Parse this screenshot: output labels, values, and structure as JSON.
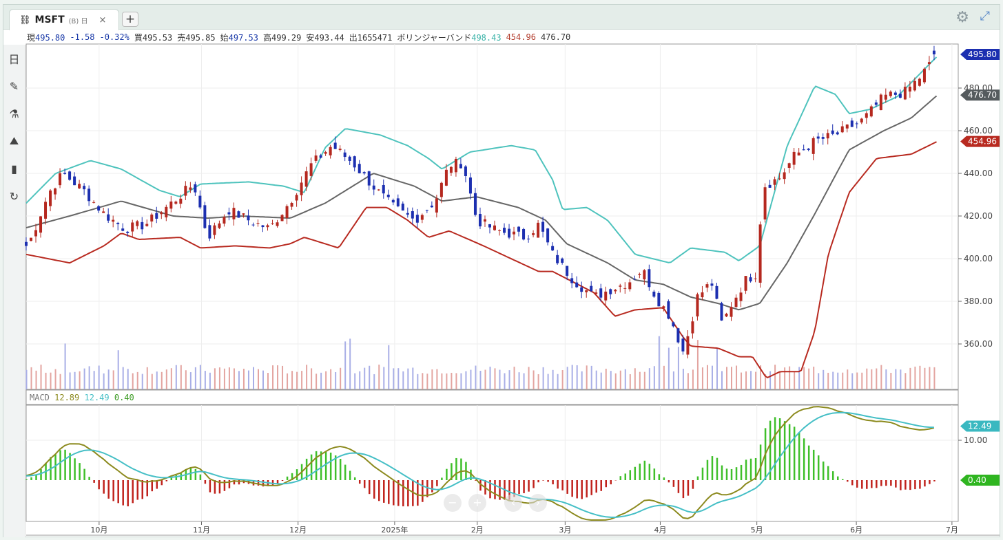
{
  "tab": {
    "symbol": "MSFT",
    "sub": "(B) 日",
    "close": "×",
    "add": "+"
  },
  "info": {
    "cur_l": "現",
    "cur": "495.80",
    "chg": "-1.58",
    "pct": "-0.32%",
    "bid_l": "買",
    "bid": "495.53",
    "ask_l": "売",
    "ask": "495.85",
    "open_l": "始",
    "open": "497.53",
    "high_l": "高",
    "high": "499.29",
    "low_l": "安",
    "low": "493.44",
    "vol_l": "出",
    "vol": "1655471",
    "bb_l": "ボリンジャーバンド",
    "bb_up": "498.43",
    "bb_lo": "454.96",
    "bb_mid": "476.70"
  },
  "macd_legend": {
    "label": "MACD",
    "macd": "12.89",
    "signal": "12.49",
    "hist": "0.40"
  },
  "toolbar": [
    {
      "icon": "calendar-icon",
      "g": "日"
    },
    {
      "icon": "pen-icon",
      "g": "✎"
    },
    {
      "icon": "flask-icon",
      "g": "⚗"
    },
    {
      "icon": "mountain-icon",
      "g": "⛰"
    },
    {
      "icon": "bar-chart-icon",
      "g": "▮"
    },
    {
      "icon": "refresh-icon",
      "g": "↻"
    }
  ],
  "colors": {
    "up": "#b5281f",
    "down": "#1c2fb0",
    "upper": "#4ec3bd",
    "mid": "#666666",
    "lower": "#b82a20",
    "macd": "#8c8a1e",
    "signal": "#45bfc6",
    "hist_pos": "#3fbf2a",
    "hist_neg": "#c0221c"
  },
  "chart_data": {
    "type": "candlestick",
    "x_range_days": [
      0,
      193
    ],
    "y_range": [
      342,
      500
    ],
    "y_ticks": [
      "480.00",
      "460.00",
      "440.00",
      "420.00",
      "400.00",
      "380.00",
      "360.00"
    ],
    "y_tick_values": [
      480,
      460,
      440,
      420,
      400,
      380,
      360
    ],
    "month_ticks": [
      {
        "label": "10月",
        "day": 15.1
      },
      {
        "label": "11月",
        "day": 36.3
      },
      {
        "label": "12月",
        "day": 56.3
      },
      {
        "label": "2025年",
        "day": 76.3
      },
      {
        "label": "2月",
        "day": 93.4
      },
      {
        "label": "3月",
        "day": 111.6
      },
      {
        "label": "4月",
        "day": 131.3
      },
      {
        "label": "5月",
        "day": 151.3
      },
      {
        "label": "6月",
        "day": 171.9
      },
      {
        "label": "7月",
        "day": 191.7
      }
    ],
    "price_tags": [
      {
        "label": "495.80",
        "value": 495.8,
        "color": "#1c2fb0"
      },
      {
        "label": "476.70",
        "value": 476.7,
        "color": "#555b5e"
      },
      {
        "label": "454.96",
        "value": 454.96,
        "color": "#b82a20"
      }
    ],
    "macd_ticks": [
      "10.00"
    ],
    "macd_tick_values": [
      10
    ],
    "macd_tags": [
      {
        "label": "12.49",
        "value": 12.49,
        "color": "#3ab8c0"
      },
      {
        "label": "0.40",
        "value": 0,
        "color": "#2fb520"
      }
    ],
    "closes": [
      [
        0.4,
        406
      ],
      [
        4.7,
        431
      ],
      [
        7.6,
        440
      ],
      [
        11.9,
        432
      ],
      [
        16.1,
        421
      ],
      [
        20.4,
        414
      ],
      [
        24.7,
        416
      ],
      [
        29,
        424
      ],
      [
        34.7,
        435
      ],
      [
        37.6,
        410
      ],
      [
        41.9,
        423
      ],
      [
        46.1,
        418
      ],
      [
        50.4,
        414
      ],
      [
        54.7,
        427
      ],
      [
        59,
        444
      ],
      [
        63.3,
        453
      ],
      [
        67.6,
        445
      ],
      [
        72.6,
        432
      ],
      [
        76.1,
        424
      ],
      [
        80.4,
        418
      ],
      [
        84.7,
        427
      ],
      [
        87.6,
        444
      ],
      [
        90.4,
        445
      ],
      [
        93.3,
        418
      ],
      [
        97.6,
        413
      ],
      [
        103.3,
        410
      ],
      [
        106.1,
        416
      ],
      [
        109,
        402
      ],
      [
        113.3,
        390
      ],
      [
        117.6,
        382
      ],
      [
        120.4,
        385
      ],
      [
        124.7,
        389
      ],
      [
        127.6,
        395
      ],
      [
        130.4,
        382
      ],
      [
        133.3,
        373
      ],
      [
        136.1,
        356
      ],
      [
        139,
        382
      ],
      [
        141.9,
        389
      ],
      [
        144.1,
        369
      ],
      [
        146.1,
        379
      ],
      [
        149,
        390
      ],
      [
        151.1,
        393
      ],
      [
        152.6,
        434
      ],
      [
        156.1,
        438
      ],
      [
        159,
        448
      ],
      [
        163.3,
        455
      ],
      [
        167.6,
        458
      ],
      [
        173.3,
        465
      ],
      [
        177.6,
        476
      ],
      [
        181.9,
        478
      ],
      [
        184.7,
        484
      ],
      [
        188.7,
        495.8
      ]
    ],
    "bb_mid": [
      [
        0,
        414.5
      ],
      [
        9,
        420
      ],
      [
        19.7,
        427
      ],
      [
        30.4,
        420
      ],
      [
        37.6,
        419
      ],
      [
        44.7,
        420
      ],
      [
        54.7,
        419
      ],
      [
        61.9,
        426
      ],
      [
        71.9,
        440
      ],
      [
        80.4,
        434
      ],
      [
        86.1,
        427
      ],
      [
        93.3,
        429
      ],
      [
        101.9,
        424
      ],
      [
        107.6,
        418
      ],
      [
        111.9,
        407
      ],
      [
        120.4,
        398
      ],
      [
        126.1,
        390
      ],
      [
        131.9,
        388
      ],
      [
        137.6,
        382
      ],
      [
        143.3,
        379
      ],
      [
        147.6,
        376
      ],
      [
        151.9,
        379
      ],
      [
        157.6,
        398
      ],
      [
        163.3,
        421
      ],
      [
        170.4,
        451
      ],
      [
        177.6,
        460
      ],
      [
        183.3,
        466
      ],
      [
        188.7,
        476.7
      ]
    ],
    "bb_upper": [
      [
        0,
        426
      ],
      [
        6.1,
        440
      ],
      [
        13.3,
        446
      ],
      [
        19.7,
        442
      ],
      [
        27.6,
        432
      ],
      [
        31.9,
        429
      ],
      [
        36.1,
        435
      ],
      [
        46.1,
        436
      ],
      [
        53.3,
        434
      ],
      [
        57.6,
        431
      ],
      [
        61.9,
        452
      ],
      [
        66.1,
        461
      ],
      [
        73.3,
        458
      ],
      [
        79,
        453
      ],
      [
        83.3,
        447
      ],
      [
        86.1,
        442
      ],
      [
        91.9,
        450
      ],
      [
        100.4,
        453
      ],
      [
        105.4,
        451
      ],
      [
        109,
        437
      ],
      [
        111.1,
        423
      ],
      [
        116.1,
        424
      ],
      [
        120.4,
        418
      ],
      [
        126.1,
        402
      ],
      [
        133.3,
        398
      ],
      [
        137.6,
        405
      ],
      [
        144.7,
        403
      ],
      [
        147.6,
        399
      ],
      [
        151.9,
        406
      ],
      [
        157.6,
        453
      ],
      [
        163.3,
        481
      ],
      [
        167.6,
        477
      ],
      [
        170.4,
        468
      ],
      [
        174.7,
        470
      ],
      [
        180.4,
        476
      ],
      [
        188.7,
        495
      ]
    ],
    "bb_lower": [
      [
        0,
        402
      ],
      [
        9,
        398
      ],
      [
        16.1,
        406
      ],
      [
        19.7,
        412
      ],
      [
        23.3,
        409
      ],
      [
        31.9,
        410
      ],
      [
        36.1,
        405
      ],
      [
        43.3,
        406
      ],
      [
        50.4,
        405
      ],
      [
        54.7,
        407
      ],
      [
        57.6,
        410
      ],
      [
        64.7,
        405
      ],
      [
        70.4,
        424
      ],
      [
        74.7,
        424
      ],
      [
        79,
        418
      ],
      [
        83.3,
        410
      ],
      [
        87.6,
        413
      ],
      [
        94.7,
        406
      ],
      [
        100.4,
        400
      ],
      [
        106.1,
        394
      ],
      [
        109,
        394
      ],
      [
        113.3,
        389
      ],
      [
        117.6,
        384
      ],
      [
        121.9,
        373
      ],
      [
        126.1,
        376
      ],
      [
        131.9,
        377
      ],
      [
        136.1,
        363
      ],
      [
        137.6,
        359
      ],
      [
        143.3,
        358
      ],
      [
        147.6,
        354
      ],
      [
        150.4,
        354
      ],
      [
        153.3,
        344
      ],
      [
        156.1,
        347
      ],
      [
        160.4,
        347
      ],
      [
        163.3,
        366
      ],
      [
        166.1,
        402
      ],
      [
        170.4,
        431
      ],
      [
        176.1,
        447
      ],
      [
        183.3,
        449
      ],
      [
        188.7,
        455
      ]
    ]
  }
}
